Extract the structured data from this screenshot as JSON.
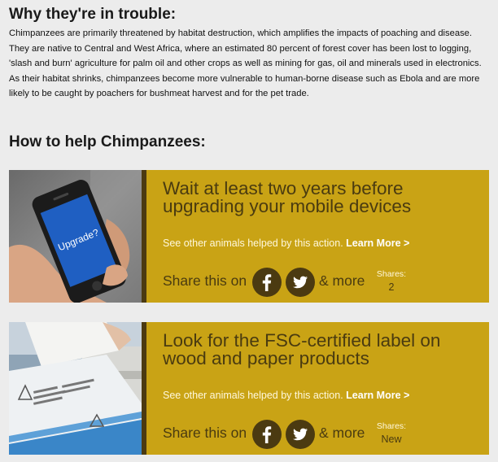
{
  "trouble": {
    "heading": "Why they're in trouble:",
    "text": "Chimpanzees are primarily threatened by habitat destruction, which amplifies the impacts of poaching and disease. They are native to Central and West Africa, where an estimated 80 percent of forest cover has been lost to logging, 'slash and burn' agriculture for palm oil and other crops as well as mining for gas, oil and minerals used in electronics. As their habitat shrinks, chimpanzees become more vulnerable to human-borne disease such as Ebola and are more likely to be caught by poachers for bushmeat harvest and for the pet trade."
  },
  "help": {
    "heading": "How to help Chimpanzees:",
    "actions": [
      {
        "title": "Wait at least two years before upgrading your mobile devices",
        "see_text": "See other animals helped by this action.",
        "learn_more": "Learn More >",
        "share_label": "Share this on",
        "more_label": "& more",
        "shares_label": "Shares:",
        "shares_value": "2",
        "photo_text": "Upgrade?"
      },
      {
        "title": "Look for the FSC-certified label on wood and paper products",
        "see_text": "See other animals helped by this action.",
        "learn_more": "Learn More >",
        "share_label": "Share this on",
        "more_label": "& more",
        "shares_label": "Shares:",
        "shares_value": "New"
      }
    ]
  },
  "colors": {
    "page_bg": "#ececec",
    "card_bg": "#c9a315",
    "card_dark": "#4b3a11",
    "phone_screen": "#1f5fc2"
  },
  "icons": [
    "facebook-icon",
    "twitter-icon"
  ]
}
